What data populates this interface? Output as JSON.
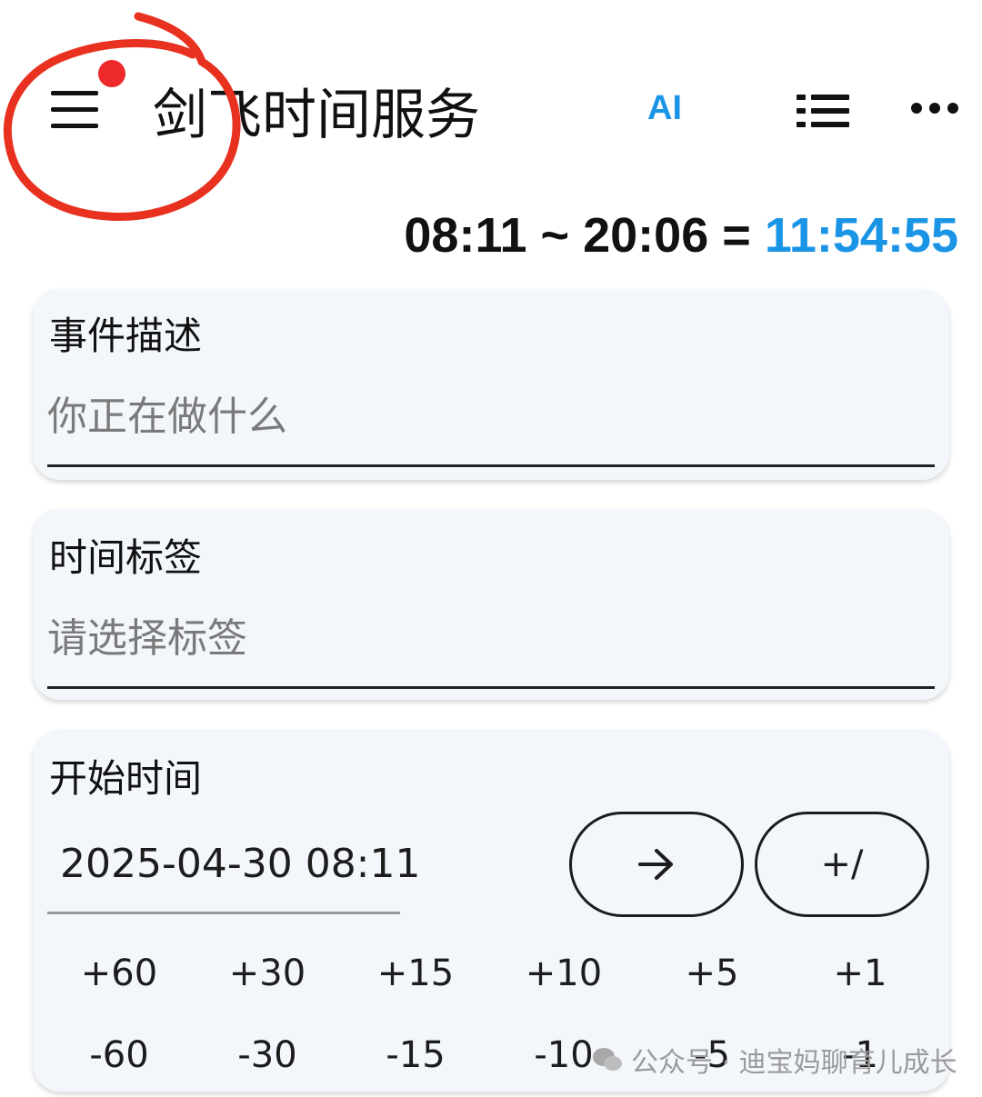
{
  "app_bar": {
    "title": "剑飞时间服务",
    "ai_label": "AI",
    "icons": {
      "menu": "menu-icon",
      "list": "list-icon",
      "more": "more-icon"
    },
    "notification_color": "#ee2a2a"
  },
  "duration": {
    "start": "08:11",
    "separator": "~",
    "end": "20:06",
    "equals": "=",
    "total": "11:54:55",
    "accent": "#1a95e6"
  },
  "event": {
    "label": "事件描述",
    "placeholder": "你正在做什么",
    "value": ""
  },
  "tag": {
    "label": "时间标签",
    "placeholder": "请选择标签",
    "value": ""
  },
  "start_time": {
    "label": "开始时间",
    "value": "2025-04-30 08:11",
    "arrow_icon": "arrow-right-icon",
    "toggle_label": "+/",
    "plus": [
      "+60",
      "+30",
      "+15",
      "+10",
      "+5",
      "+1"
    ],
    "minus": [
      "-60",
      "-30",
      "-15",
      "-10",
      "-5",
      "-1"
    ]
  },
  "watermark": {
    "text": "公众号 · 迪宝妈聊育儿成长",
    "icon": "wechat-icon"
  }
}
